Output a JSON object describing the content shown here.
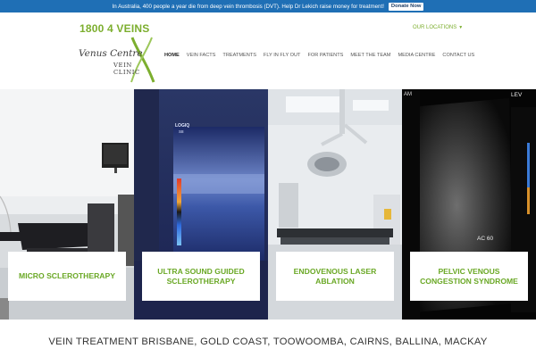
{
  "topbar": {
    "message": "In Australia, 400 people a year die from deep vein thrombosis (DVT). Help Dr Lekich raise money for treatment!",
    "donate_label": "Donate Now"
  },
  "header": {
    "phone": "1800 4 VEINS",
    "logo_script": "Venus Centre",
    "logo_sub1": "VEIN",
    "logo_sub2": "CLINIC",
    "locations_label": "OUR LOCATIONS",
    "nav": [
      "HOME",
      "VEIN FACTS",
      "TREATMENTS",
      "FLY IN FLY OUT",
      "FOR PATIENTS",
      "MEET THE TEAM",
      "MEDIA CENTRE",
      "CONTACT US"
    ]
  },
  "panels": [
    {
      "label": "MICRO SCLEROTHERAPY",
      "image": "treatment-room-photo"
    },
    {
      "label": "ULTRA SOUND GUIDED SCLEROTHERAPY",
      "image": "ultrasound-monitor-photo"
    },
    {
      "label": "ENDOVENOUS LASER ABLATION",
      "image": "operating-theatre-photo"
    },
    {
      "label": "PELVIC VENOUS CONGESTION SYNDROME",
      "image": "ultrasound-scan-photo"
    }
  ],
  "ultrasound_text": {
    "logiq": "LOGIQ",
    "logiq_sub": "S8",
    "panel4_top": "LEV",
    "panel4_am": "AM",
    "ac": "AC 60"
  },
  "heading": "VEIN TREATMENT BRISBANE, GOLD COAST, TOOWOOMBA, CAIRNS, BALLINA, MACKAY",
  "colors": {
    "brand_green": "#7cae2e",
    "topbar_blue": "#1f6fb5"
  }
}
